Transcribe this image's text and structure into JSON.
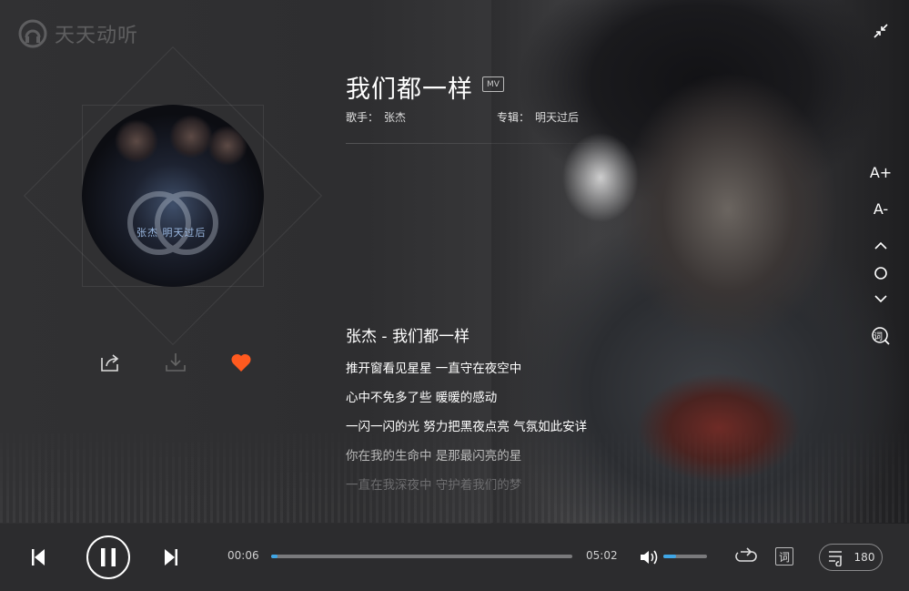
{
  "app": {
    "logo_text": "天天动听"
  },
  "album": {
    "disc_label": "张杰 明天过后"
  },
  "song": {
    "title": "我们都一样",
    "mv_label": "MV",
    "artist_label": "歌手：",
    "artist": "张杰",
    "album_label": "专辑：",
    "album": "明天过后"
  },
  "lyrics": {
    "heading": "张杰 - 我们都一样",
    "lines": [
      {
        "text": "推开窗看见星星 一直守在夜空中",
        "color": "#ffffff"
      },
      {
        "text": "心中不免多了些 暖暖的感动",
        "color": "#ffffff"
      },
      {
        "text": "一闪一闪的光 努力把黑夜点亮 气氛如此安详",
        "color": "#ffffff"
      },
      {
        "text": "你在我的生命中 是那最闪亮的星",
        "color": "#b9b9b9"
      },
      {
        "text": "一直在我深夜中 守护着我们的梦",
        "color": "#6d6d6f"
      }
    ]
  },
  "side_tools": {
    "font_up": "A+",
    "font_down": "A-",
    "lyric_icon": "词"
  },
  "player": {
    "elapsed": "00:06",
    "duration": "05:02",
    "progress": 0.02,
    "volume": 0.3,
    "lyric_toggle": "词",
    "playlist_count": "180"
  },
  "colors": {
    "accent": "#3fa6e6",
    "like": "#ff5a1f"
  }
}
